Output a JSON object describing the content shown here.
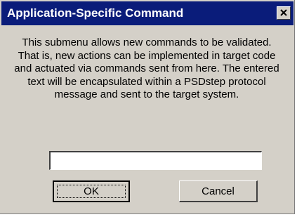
{
  "dialog": {
    "title": "Application-Specific Command",
    "message": "This submenu allows new commands to be validated.  That is, new actions can be implemented in target code and actuated via commands sent from here.  The entered text will be encapsulated within a PSDstep protocol message and sent to the target system.",
    "command_input": {
      "value": "",
      "placeholder": ""
    },
    "buttons": {
      "ok_label": "OK",
      "cancel_label": "Cancel"
    }
  },
  "colors": {
    "titlebar": "#0a1c7a",
    "dialog_face": "#d4d0c8",
    "title_text": "#ffffff"
  },
  "icons": {
    "close": "close-icon"
  }
}
